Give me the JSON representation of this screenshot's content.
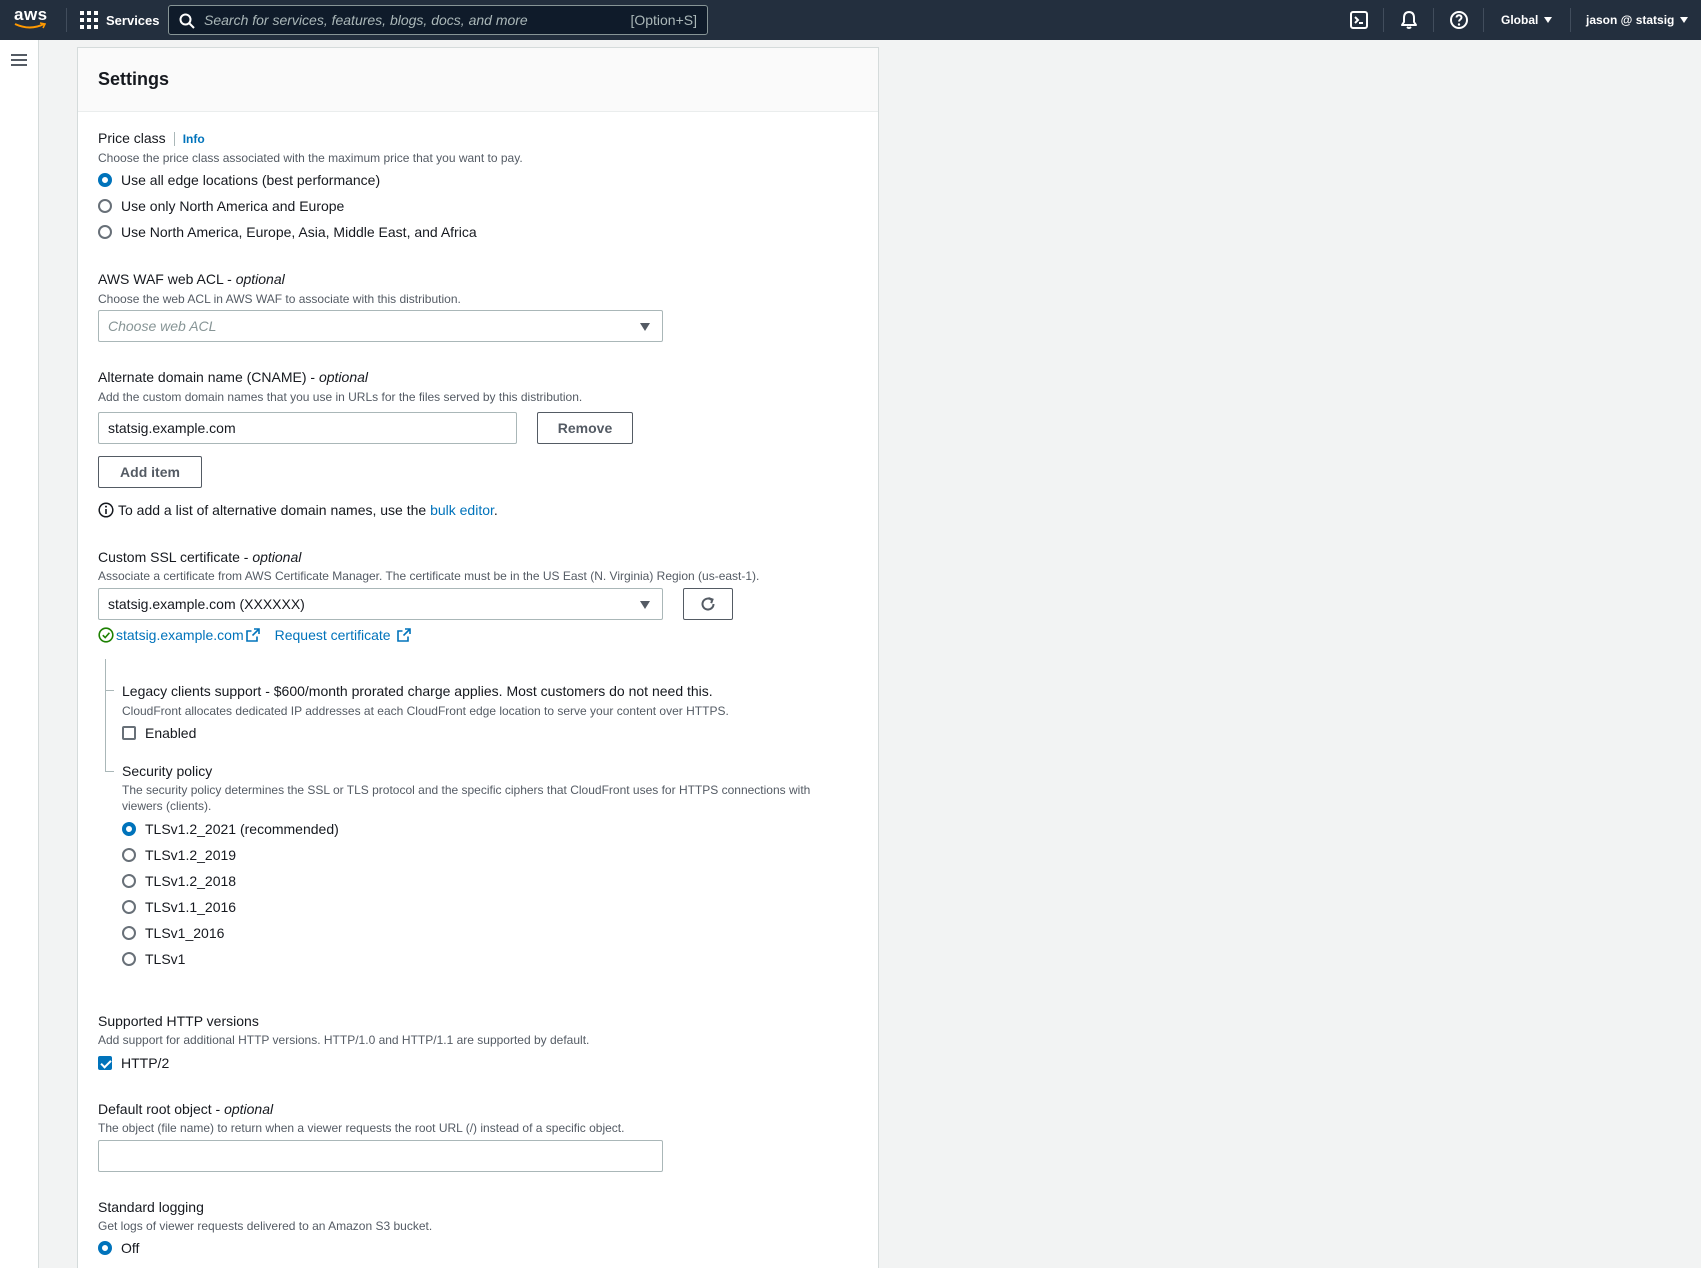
{
  "nav": {
    "logo": "aws",
    "services_label": "Services",
    "search_placeholder": "Search for services, features, blogs, docs, and more",
    "search_shortcut": "[Option+S]",
    "region": "Global",
    "account": "jason @ statsig",
    "icons": [
      "terminal-icon",
      "bell-icon",
      "help-icon"
    ]
  },
  "panel": {
    "title": "Settings"
  },
  "price_class": {
    "label": "Price class",
    "info": "Info",
    "description": "Choose the price class associated with the maximum price that you want to pay.",
    "options": [
      "Use all edge locations (best performance)",
      "Use only North America and Europe",
      "Use North America, Europe, Asia, Middle East, and Africa"
    ],
    "selected_index": 0
  },
  "waf": {
    "label": "AWS WAF web ACL - ",
    "optional": "optional",
    "description": "Choose the web ACL in AWS WAF to associate with this distribution.",
    "placeholder": "Choose web ACL"
  },
  "cname": {
    "label": "Alternate domain name (CNAME) - ",
    "optional": "optional",
    "description": "Add the custom domain names that you use in URLs for the files served by this distribution.",
    "value": "statsig.example.com",
    "remove_label": "Remove",
    "add_label": "Add item",
    "hint_prefix": "To add a list of alternative domain names, use the ",
    "hint_link": "bulk editor",
    "hint_suffix": "."
  },
  "ssl": {
    "label": "Custom SSL certificate - ",
    "optional": "optional",
    "description": "Associate a certificate from AWS Certificate Manager. The certificate must be in the US East (N. Virginia) Region (us-east-1).",
    "selected": "statsig.example.com (XXXXXX)",
    "cert_link": "statsig.example.com",
    "request_link": "Request certificate"
  },
  "legacy": {
    "label": "Legacy clients support - $600/month prorated charge applies. Most customers do not need this.",
    "description": "CloudFront allocates dedicated IP addresses at each CloudFront edge location to serve your content over HTTPS.",
    "checkbox_label": "Enabled",
    "checked": false
  },
  "security_policy": {
    "label": "Security policy",
    "description_line1": "The security policy determines the SSL or TLS protocol and the specific ciphers that CloudFront uses for HTTPS connections with",
    "description_line2": "viewers (clients).",
    "options": [
      "TLSv1.2_2021 (recommended)",
      "TLSv1.2_2019",
      "TLSv1.2_2018",
      "TLSv1.1_2016",
      "TLSv1_2016",
      "TLSv1"
    ],
    "selected_index": 0
  },
  "http_versions": {
    "label": "Supported HTTP versions",
    "description": "Add support for additional HTTP versions. HTTP/1.0 and HTTP/1.1 are supported by default.",
    "checkbox_label": "HTTP/2",
    "checked": true
  },
  "root_object": {
    "label": "Default root object - ",
    "optional": "optional",
    "description": "The object (file name) to return when a viewer requests the root URL (/) instead of a specific object.",
    "value": ""
  },
  "logging": {
    "label": "Standard logging",
    "description": "Get logs of viewer requests delivered to an Amazon S3 bucket.",
    "option": "Off"
  },
  "colors": {
    "nav_bg": "#232f3e",
    "link": "#0073bb",
    "success": "#1d8102"
  }
}
